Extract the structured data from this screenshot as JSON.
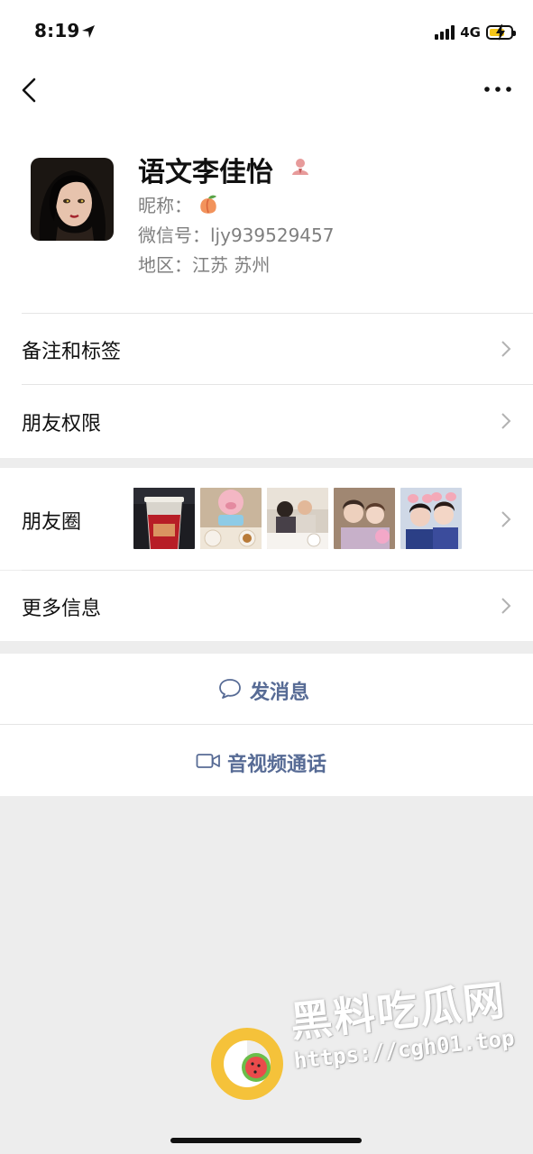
{
  "status_bar": {
    "time": "8:19",
    "network": "4G",
    "battery_level": 0.6,
    "battery_color": "#f5c518",
    "icons": [
      "location-arrow-icon",
      "signal-bars-icon",
      "battery-charging-icon"
    ]
  },
  "nav": {
    "back_icon": "chevron-left-icon",
    "more_icon": "more-dots-icon"
  },
  "profile": {
    "name": "语文李佳怡",
    "name_badge_icon": "person-badge-icon",
    "nickname_label": "昵称：",
    "nickname_icon": "peach-emoji-icon",
    "wechat_id_line": "微信号：ljy939529457",
    "region_line": "地区：江苏 苏州"
  },
  "rows": {
    "remark": "备注和标签",
    "permissions": "朋友权限",
    "moments": "朋友圈",
    "more_info": "更多信息"
  },
  "moments_thumbnails": [
    {
      "subject": "red-cup-photo"
    },
    {
      "subject": "pig-hat-dinner-photo"
    },
    {
      "subject": "restaurant-group-photo"
    },
    {
      "subject": "friends-selfie-photo"
    },
    {
      "subject": "pig-ears-selfie-photo"
    }
  ],
  "actions": {
    "send_message": "发消息",
    "send_message_icon": "chat-bubble-icon",
    "video_call": "音视频通话",
    "video_call_icon": "video-camera-icon"
  },
  "watermark": {
    "title": "黑料吃瓜网",
    "url": "https://cgh01.top"
  },
  "colors": {
    "link_blue": "#576b95",
    "background": "#ededed",
    "secondary_text": "#7f7f7f"
  }
}
